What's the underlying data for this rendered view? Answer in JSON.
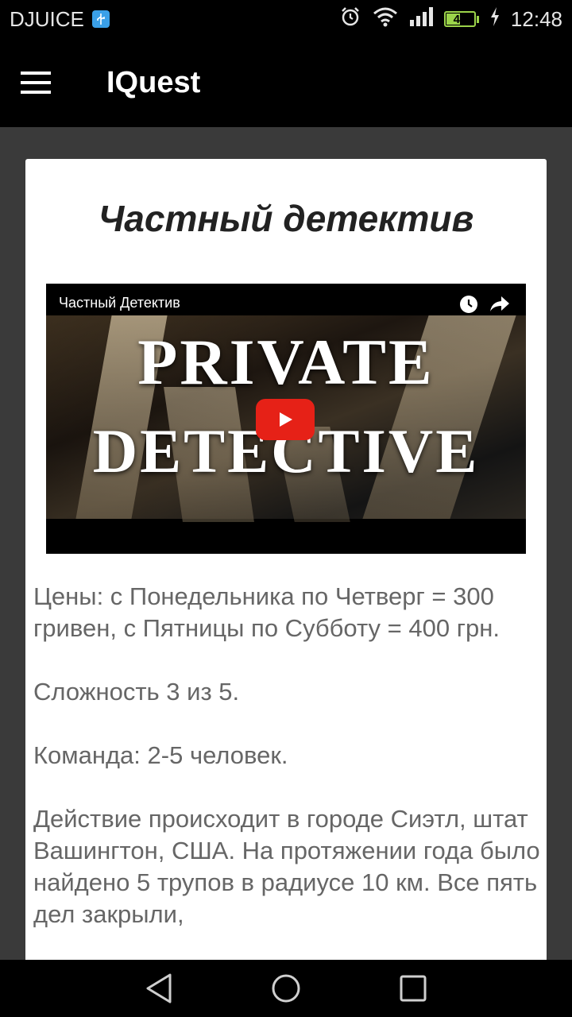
{
  "status_bar": {
    "carrier": "DJUICE",
    "battery_level": "49",
    "battery_fraction": 0.49,
    "time": "12:48",
    "icons": [
      "usb-icon",
      "alarm-icon",
      "wifi-icon",
      "signal-icon",
      "battery-icon",
      "charging-icon"
    ]
  },
  "app_bar": {
    "title": "IQuest",
    "menu_icon": "hamburger-menu-icon"
  },
  "quest": {
    "title": "Частный детектив",
    "video": {
      "title": "Частный Детектив",
      "thumbnail_line1": "PRIVATE",
      "thumbnail_line2": "DETECTIVE",
      "icons": [
        "watch-later-icon",
        "share-icon",
        "play-icon"
      ]
    },
    "paragraphs": [
      "Цены: с Понедельника по Четверг = 300 гривен, с Пятницы по Субботу = 400 грн.",
      "Сложность 3 из 5.",
      "Команда: 2-5 человек.",
      "Действие происходит в городе Сиэтл, штат Вашингтон, США. На протяжении года было найдено 5 трупов в радиусе 10 км. Все пять дел закрыли,"
    ]
  },
  "nav_bar": {
    "icons": [
      "back-icon",
      "home-icon",
      "recents-icon"
    ]
  },
  "colors": {
    "status_bar_bg": "#000000",
    "app_bar_bg": "#000000",
    "page_bg": "#3a3a3a",
    "card_bg": "#ffffff",
    "battery": "#9bd34a",
    "play_button": "#e62117"
  }
}
